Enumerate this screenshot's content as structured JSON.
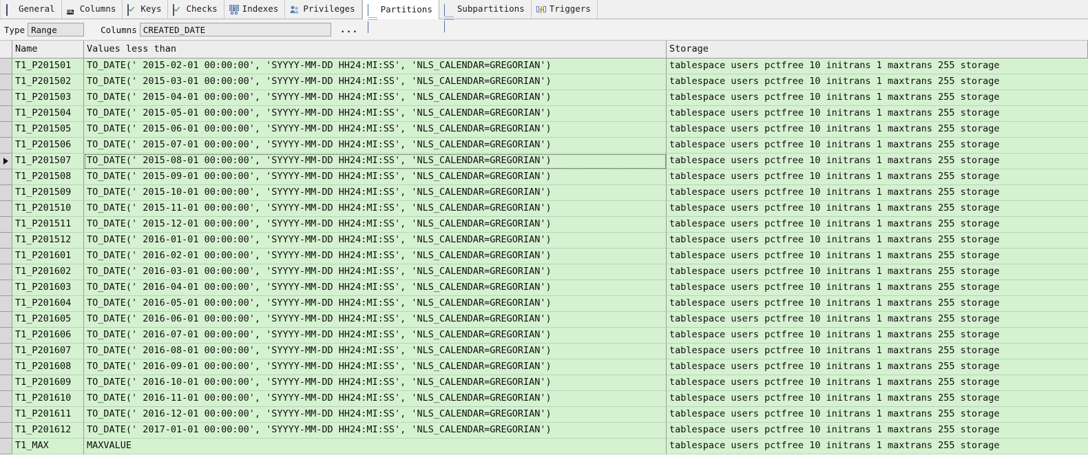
{
  "tabs": [
    {
      "label": "General",
      "icon": "page-icon",
      "active": false
    },
    {
      "label": "Columns",
      "icon": "columns-icon",
      "active": false
    },
    {
      "label": "Keys",
      "icon": "key-check-icon",
      "active": false
    },
    {
      "label": "Checks",
      "icon": "check-icon",
      "active": false
    },
    {
      "label": "Indexes",
      "icon": "index-tree-icon",
      "active": false
    },
    {
      "label": "Privileges",
      "icon": "users-icon",
      "active": false
    },
    {
      "label": "Partitions",
      "icon": "table-grid-icon",
      "active": true
    },
    {
      "label": "Subpartitions",
      "icon": "table-grid-icon",
      "active": false
    },
    {
      "label": "Triggers",
      "icon": "trigger-icon",
      "active": false
    }
  ],
  "properties": {
    "type_label": "Type",
    "type_value": "Range",
    "columns_label": "Columns",
    "columns_value": "CREATED_DATE",
    "more_button_label": "..."
  },
  "grid": {
    "columns": [
      "Name",
      "Values less than",
      "Storage"
    ],
    "current_row_index": 6,
    "storage_value": "tablespace users pctfree 10 initrans 1 maxtrans 255 storage",
    "rows": [
      {
        "name": "T1_P201501",
        "values": "TO_DATE(' 2015-02-01 00:00:00', 'SYYYY-MM-DD HH24:MI:SS', 'NLS_CALENDAR=GREGORIAN')",
        "storage": "tablespace users pctfree 10 initrans 1 maxtrans 255 storage"
      },
      {
        "name": "T1_P201502",
        "values": "TO_DATE(' 2015-03-01 00:00:00', 'SYYYY-MM-DD HH24:MI:SS', 'NLS_CALENDAR=GREGORIAN')",
        "storage": "tablespace users pctfree 10 initrans 1 maxtrans 255 storage"
      },
      {
        "name": "T1_P201503",
        "values": "TO_DATE(' 2015-04-01 00:00:00', 'SYYYY-MM-DD HH24:MI:SS', 'NLS_CALENDAR=GREGORIAN')",
        "storage": "tablespace users pctfree 10 initrans 1 maxtrans 255 storage"
      },
      {
        "name": "T1_P201504",
        "values": "TO_DATE(' 2015-05-01 00:00:00', 'SYYYY-MM-DD HH24:MI:SS', 'NLS_CALENDAR=GREGORIAN')",
        "storage": "tablespace users pctfree 10 initrans 1 maxtrans 255 storage"
      },
      {
        "name": "T1_P201505",
        "values": "TO_DATE(' 2015-06-01 00:00:00', 'SYYYY-MM-DD HH24:MI:SS', 'NLS_CALENDAR=GREGORIAN')",
        "storage": "tablespace users pctfree 10 initrans 1 maxtrans 255 storage"
      },
      {
        "name": "T1_P201506",
        "values": "TO_DATE(' 2015-07-01 00:00:00', 'SYYYY-MM-DD HH24:MI:SS', 'NLS_CALENDAR=GREGORIAN')",
        "storage": "tablespace users pctfree 10 initrans 1 maxtrans 255 storage"
      },
      {
        "name": "T1_P201507",
        "values": "TO_DATE(' 2015-08-01 00:00:00', 'SYYYY-MM-DD HH24:MI:SS', 'NLS_CALENDAR=GREGORIAN')",
        "storage": "tablespace users pctfree 10 initrans 1 maxtrans 255 storage"
      },
      {
        "name": "T1_P201508",
        "values": "TO_DATE(' 2015-09-01 00:00:00', 'SYYYY-MM-DD HH24:MI:SS', 'NLS_CALENDAR=GREGORIAN')",
        "storage": "tablespace users pctfree 10 initrans 1 maxtrans 255 storage"
      },
      {
        "name": "T1_P201509",
        "values": "TO_DATE(' 2015-10-01 00:00:00', 'SYYYY-MM-DD HH24:MI:SS', 'NLS_CALENDAR=GREGORIAN')",
        "storage": "tablespace users pctfree 10 initrans 1 maxtrans 255 storage"
      },
      {
        "name": "T1_P201510",
        "values": "TO_DATE(' 2015-11-01 00:00:00', 'SYYYY-MM-DD HH24:MI:SS', 'NLS_CALENDAR=GREGORIAN')",
        "storage": "tablespace users pctfree 10 initrans 1 maxtrans 255 storage"
      },
      {
        "name": "T1_P201511",
        "values": "TO_DATE(' 2015-12-01 00:00:00', 'SYYYY-MM-DD HH24:MI:SS', 'NLS_CALENDAR=GREGORIAN')",
        "storage": "tablespace users pctfree 10 initrans 1 maxtrans 255 storage"
      },
      {
        "name": "T1_P201512",
        "values": "TO_DATE(' 2016-01-01 00:00:00', 'SYYYY-MM-DD HH24:MI:SS', 'NLS_CALENDAR=GREGORIAN')",
        "storage": "tablespace users pctfree 10 initrans 1 maxtrans 255 storage"
      },
      {
        "name": "T1_P201601",
        "values": "TO_DATE(' 2016-02-01 00:00:00', 'SYYYY-MM-DD HH24:MI:SS', 'NLS_CALENDAR=GREGORIAN')",
        "storage": "tablespace users pctfree 10 initrans 1 maxtrans 255 storage"
      },
      {
        "name": "T1_P201602",
        "values": "TO_DATE(' 2016-03-01 00:00:00', 'SYYYY-MM-DD HH24:MI:SS', 'NLS_CALENDAR=GREGORIAN')",
        "storage": "tablespace users pctfree 10 initrans 1 maxtrans 255 storage"
      },
      {
        "name": "T1_P201603",
        "values": "TO_DATE(' 2016-04-01 00:00:00', 'SYYYY-MM-DD HH24:MI:SS', 'NLS_CALENDAR=GREGORIAN')",
        "storage": "tablespace users pctfree 10 initrans 1 maxtrans 255 storage"
      },
      {
        "name": "T1_P201604",
        "values": "TO_DATE(' 2016-05-01 00:00:00', 'SYYYY-MM-DD HH24:MI:SS', 'NLS_CALENDAR=GREGORIAN')",
        "storage": "tablespace users pctfree 10 initrans 1 maxtrans 255 storage"
      },
      {
        "name": "T1_P201605",
        "values": "TO_DATE(' 2016-06-01 00:00:00', 'SYYYY-MM-DD HH24:MI:SS', 'NLS_CALENDAR=GREGORIAN')",
        "storage": "tablespace users pctfree 10 initrans 1 maxtrans 255 storage"
      },
      {
        "name": "T1_P201606",
        "values": "TO_DATE(' 2016-07-01 00:00:00', 'SYYYY-MM-DD HH24:MI:SS', 'NLS_CALENDAR=GREGORIAN')",
        "storage": "tablespace users pctfree 10 initrans 1 maxtrans 255 storage"
      },
      {
        "name": "T1_P201607",
        "values": "TO_DATE(' 2016-08-01 00:00:00', 'SYYYY-MM-DD HH24:MI:SS', 'NLS_CALENDAR=GREGORIAN')",
        "storage": "tablespace users pctfree 10 initrans 1 maxtrans 255 storage"
      },
      {
        "name": "T1_P201608",
        "values": "TO_DATE(' 2016-09-01 00:00:00', 'SYYYY-MM-DD HH24:MI:SS', 'NLS_CALENDAR=GREGORIAN')",
        "storage": "tablespace users pctfree 10 initrans 1 maxtrans 255 storage"
      },
      {
        "name": "T1_P201609",
        "values": "TO_DATE(' 2016-10-01 00:00:00', 'SYYYY-MM-DD HH24:MI:SS', 'NLS_CALENDAR=GREGORIAN')",
        "storage": "tablespace users pctfree 10 initrans 1 maxtrans 255 storage"
      },
      {
        "name": "T1_P201610",
        "values": "TO_DATE(' 2016-11-01 00:00:00', 'SYYYY-MM-DD HH24:MI:SS', 'NLS_CALENDAR=GREGORIAN')",
        "storage": "tablespace users pctfree 10 initrans 1 maxtrans 255 storage"
      },
      {
        "name": "T1_P201611",
        "values": "TO_DATE(' 2016-12-01 00:00:00', 'SYYYY-MM-DD HH24:MI:SS', 'NLS_CALENDAR=GREGORIAN')",
        "storage": "tablespace users pctfree 10 initrans 1 maxtrans 255 storage"
      },
      {
        "name": "T1_P201612",
        "values": "TO_DATE(' 2017-01-01 00:00:00', 'SYYYY-MM-DD HH24:MI:SS', 'NLS_CALENDAR=GREGORIAN')",
        "storage": "tablespace users pctfree 10 initrans 1 maxtrans 255 storage"
      },
      {
        "name": "T1_MAX",
        "values": "MAXVALUE",
        "storage": "tablespace users pctfree 10 initrans 1 maxtrans 255 storage"
      }
    ]
  },
  "colors": {
    "row_green": "#d5f2d0",
    "header_gray": "#ededed",
    "gutter_gray": "#d9d9d9",
    "grid_line": "#9a9a9a",
    "tab_active": "#ffffff",
    "tab_inactive": "#f0f0f0"
  }
}
